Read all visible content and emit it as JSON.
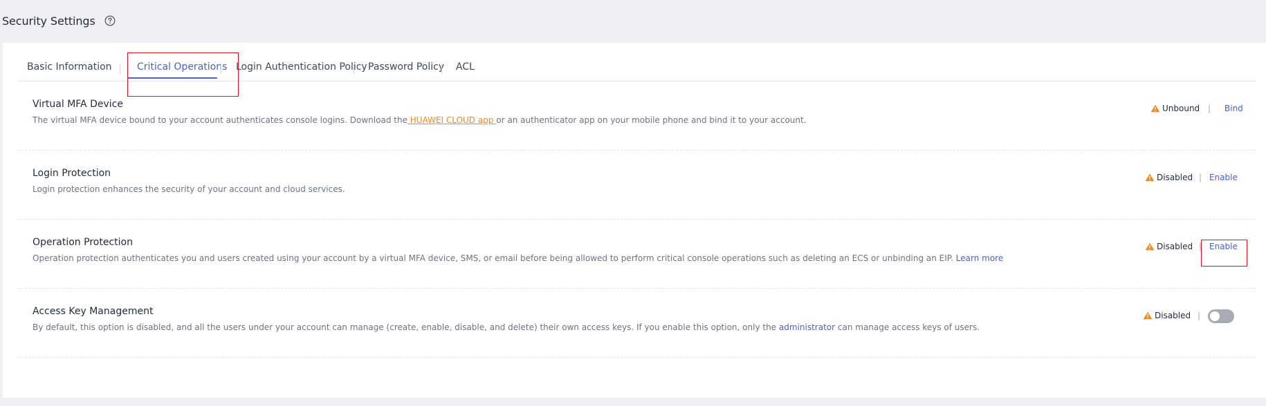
{
  "header": {
    "title": "Security Settings",
    "help_icon": "question-circle-icon"
  },
  "tabs": [
    {
      "label": "Basic Information",
      "active": false
    },
    {
      "label": "Critical Operations",
      "active": true
    },
    {
      "label": "Login Authentication Policy",
      "active": false
    },
    {
      "label": "Password Policy",
      "active": false
    },
    {
      "label": "ACL",
      "active": false
    }
  ],
  "rows": {
    "mfa": {
      "title": "Virtual MFA Device",
      "desc_before": "The virtual MFA device bound to your account authenticates console logins. Download the",
      "desc_link": " HUAWEI CLOUD app ",
      "desc_after": "or an authenticator app on your mobile phone and bind it to your account.",
      "status": "Unbound",
      "separator": "|",
      "action": "Bind"
    },
    "login_protection": {
      "title": "Login Protection",
      "desc": "Login protection enhances the security of your account and cloud services.",
      "status": "Disabled",
      "separator": "|",
      "action": "Enable"
    },
    "operation_protection": {
      "title": "Operation Protection",
      "desc": "Operation protection authenticates you and users created using your account by a virtual MFA device, SMS, or email before being allowed to perform critical console operations such as deleting an ECS or unbinding an EIP.",
      "desc_link": "Learn more",
      "status": "Disabled",
      "separator": "|",
      "action": "Enable"
    },
    "access_key": {
      "title": "Access Key Management",
      "desc_before": "By default, this option is disabled, and all the users under your account can manage (create, enable, disable, and delete) their own access keys. If you enable this option, only the",
      "desc_link": "administrator",
      "desc_after": "can manage access keys of users.",
      "status": "Disabled",
      "separator": "|",
      "toggle_on": false
    }
  },
  "colors": {
    "accent": "#4a5fc1",
    "warning": "#f28a17",
    "highlight": "#e0141e",
    "page_bg": "#eff0f4"
  }
}
